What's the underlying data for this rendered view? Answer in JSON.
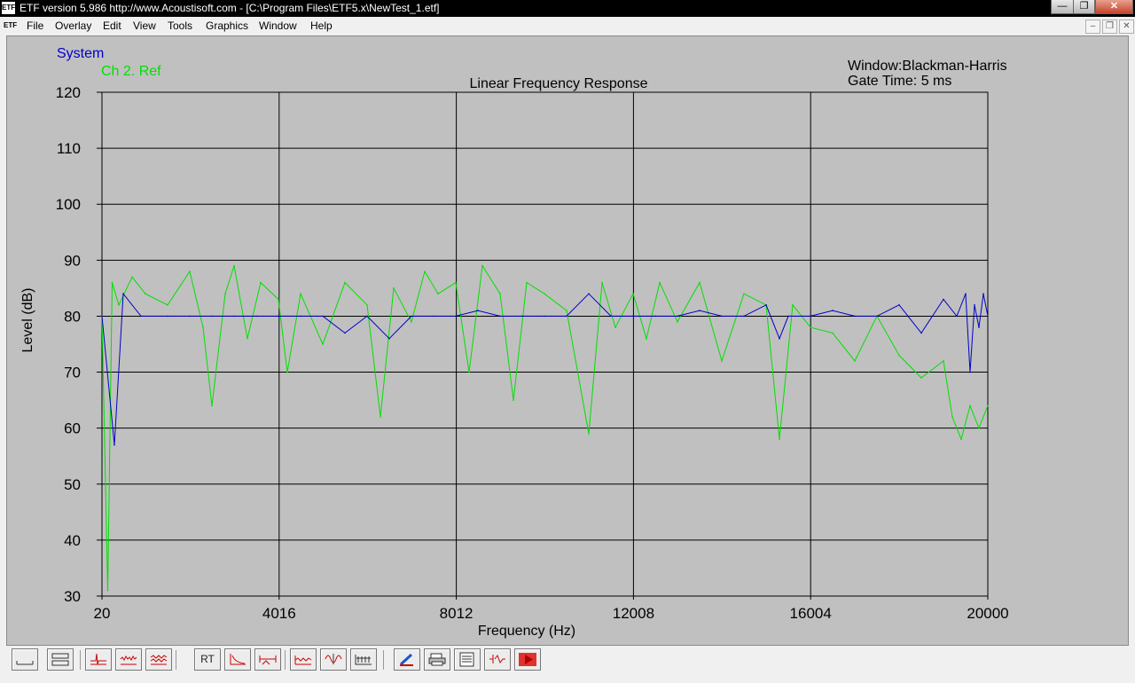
{
  "window": {
    "app_icon": "ETF",
    "title": "ETF version 5.986 http://www.Acoustisoft.com - [C:\\Program Files\\ETF5.x\\NewTest_1.etf]",
    "minimize_glyph": "—",
    "maximize_glyph": "❐",
    "close_glyph": "✕"
  },
  "menubar": {
    "doc_icon": "ETF",
    "items": [
      "File",
      "Overlay",
      "Edit",
      "View",
      "Tools",
      "Graphics",
      "Window",
      "Help"
    ],
    "mdi_minimize": "–",
    "mdi_restore": "❐",
    "mdi_close": "✕"
  },
  "legend": [
    {
      "label": "System",
      "color": "#0000c8"
    },
    {
      "label": "Ch 2. Ref",
      "color": "#00e000"
    }
  ],
  "info": {
    "window_line": "Window:Blackman-Harris",
    "gate_line": "Gate Time:  5 ms"
  },
  "chart_data": {
    "type": "line",
    "title": "Linear Frequency Response",
    "xlabel": "Frequency (Hz)",
    "ylabel": "Level (dB)",
    "xlim": [
      20,
      20000
    ],
    "ylim": [
      30,
      120
    ],
    "xticks": [
      20,
      4016,
      8012,
      12008,
      16004,
      20000
    ],
    "yticks": [
      120,
      110,
      100,
      90,
      80,
      70,
      60,
      50,
      40,
      30
    ],
    "grid": true,
    "background": "#c0c0c0",
    "legend_position": "top-left",
    "series": [
      {
        "name": "System",
        "color": "#0000c8",
        "x": [
          20,
          300,
          500,
          900,
          1500,
          2000,
          2500,
          3000,
          3500,
          4000,
          4500,
          5000,
          5500,
          6000,
          6500,
          7000,
          7500,
          8000,
          8500,
          9000,
          9500,
          10000,
          10500,
          11000,
          11500,
          12000,
          12500,
          13000,
          13500,
          14000,
          14500,
          15000,
          15300,
          15500,
          16000,
          16500,
          17000,
          17500,
          18000,
          18500,
          19000,
          19300,
          19500,
          19600,
          19700,
          19800,
          19900,
          20000
        ],
        "y": [
          80,
          57,
          84,
          80,
          80,
          80,
          80,
          80,
          80,
          80,
          80,
          80,
          77,
          80,
          76,
          80,
          80,
          80,
          81,
          80,
          80,
          80,
          80,
          84,
          80,
          80,
          80,
          80,
          81,
          80,
          80,
          82,
          76,
          80,
          80,
          81,
          80,
          80,
          82,
          77,
          83,
          80,
          84,
          70,
          82,
          78,
          84,
          80
        ]
      },
      {
        "name": "Ch 2. Ref",
        "color": "#00e000",
        "x": [
          20,
          150,
          250,
          400,
          700,
          1000,
          1500,
          2000,
          2300,
          2500,
          2800,
          3000,
          3300,
          3600,
          4000,
          4200,
          4500,
          5000,
          5500,
          6000,
          6300,
          6600,
          7000,
          7300,
          7600,
          8000,
          8300,
          8600,
          9000,
          9300,
          9600,
          10000,
          10500,
          11000,
          11300,
          11600,
          12000,
          12300,
          12600,
          13000,
          13500,
          14000,
          14500,
          15000,
          15300,
          15600,
          16000,
          16500,
          17000,
          17500,
          18000,
          18500,
          19000,
          19200,
          19400,
          19600,
          19800,
          20000
        ],
        "y": [
          80,
          31,
          86,
          82,
          87,
          84,
          82,
          88,
          78,
          64,
          84,
          89,
          76,
          86,
          83,
          70,
          84,
          75,
          86,
          82,
          62,
          85,
          79,
          88,
          84,
          86,
          70,
          89,
          84,
          65,
          86,
          84,
          81,
          59,
          86,
          78,
          84,
          76,
          86,
          79,
          86,
          72,
          84,
          82,
          58,
          82,
          78,
          77,
          72,
          80,
          73,
          69,
          72,
          62,
          58,
          64,
          60,
          64
        ]
      }
    ]
  },
  "toolbar": {
    "rt_label": "RT"
  }
}
